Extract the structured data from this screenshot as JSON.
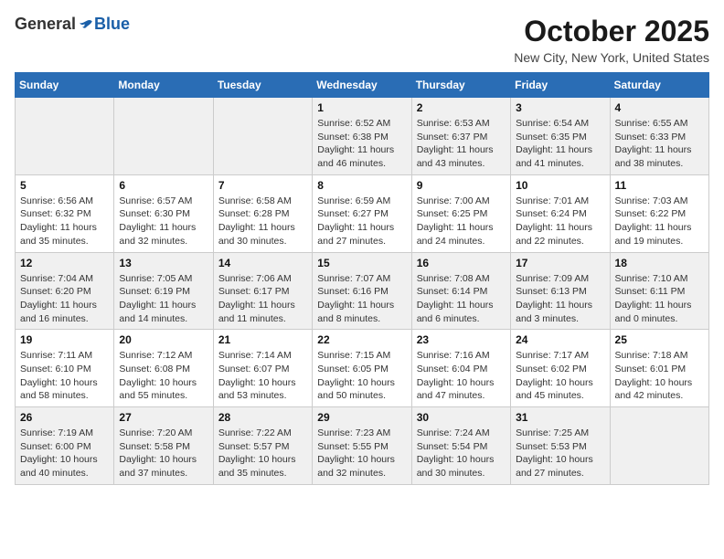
{
  "header": {
    "logo_general": "General",
    "logo_blue": "Blue",
    "month_title": "October 2025",
    "location": "New City, New York, United States"
  },
  "weekdays": [
    "Sunday",
    "Monday",
    "Tuesday",
    "Wednesday",
    "Thursday",
    "Friday",
    "Saturday"
  ],
  "weeks": [
    [
      {
        "day": "",
        "info": ""
      },
      {
        "day": "",
        "info": ""
      },
      {
        "day": "",
        "info": ""
      },
      {
        "day": "1",
        "info": "Sunrise: 6:52 AM\nSunset: 6:38 PM\nDaylight: 11 hours and 46 minutes."
      },
      {
        "day": "2",
        "info": "Sunrise: 6:53 AM\nSunset: 6:37 PM\nDaylight: 11 hours and 43 minutes."
      },
      {
        "day": "3",
        "info": "Sunrise: 6:54 AM\nSunset: 6:35 PM\nDaylight: 11 hours and 41 minutes."
      },
      {
        "day": "4",
        "info": "Sunrise: 6:55 AM\nSunset: 6:33 PM\nDaylight: 11 hours and 38 minutes."
      }
    ],
    [
      {
        "day": "5",
        "info": "Sunrise: 6:56 AM\nSunset: 6:32 PM\nDaylight: 11 hours and 35 minutes."
      },
      {
        "day": "6",
        "info": "Sunrise: 6:57 AM\nSunset: 6:30 PM\nDaylight: 11 hours and 32 minutes."
      },
      {
        "day": "7",
        "info": "Sunrise: 6:58 AM\nSunset: 6:28 PM\nDaylight: 11 hours and 30 minutes."
      },
      {
        "day": "8",
        "info": "Sunrise: 6:59 AM\nSunset: 6:27 PM\nDaylight: 11 hours and 27 minutes."
      },
      {
        "day": "9",
        "info": "Sunrise: 7:00 AM\nSunset: 6:25 PM\nDaylight: 11 hours and 24 minutes."
      },
      {
        "day": "10",
        "info": "Sunrise: 7:01 AM\nSunset: 6:24 PM\nDaylight: 11 hours and 22 minutes."
      },
      {
        "day": "11",
        "info": "Sunrise: 7:03 AM\nSunset: 6:22 PM\nDaylight: 11 hours and 19 minutes."
      }
    ],
    [
      {
        "day": "12",
        "info": "Sunrise: 7:04 AM\nSunset: 6:20 PM\nDaylight: 11 hours and 16 minutes."
      },
      {
        "day": "13",
        "info": "Sunrise: 7:05 AM\nSunset: 6:19 PM\nDaylight: 11 hours and 14 minutes."
      },
      {
        "day": "14",
        "info": "Sunrise: 7:06 AM\nSunset: 6:17 PM\nDaylight: 11 hours and 11 minutes."
      },
      {
        "day": "15",
        "info": "Sunrise: 7:07 AM\nSunset: 6:16 PM\nDaylight: 11 hours and 8 minutes."
      },
      {
        "day": "16",
        "info": "Sunrise: 7:08 AM\nSunset: 6:14 PM\nDaylight: 11 hours and 6 minutes."
      },
      {
        "day": "17",
        "info": "Sunrise: 7:09 AM\nSunset: 6:13 PM\nDaylight: 11 hours and 3 minutes."
      },
      {
        "day": "18",
        "info": "Sunrise: 7:10 AM\nSunset: 6:11 PM\nDaylight: 11 hours and 0 minutes."
      }
    ],
    [
      {
        "day": "19",
        "info": "Sunrise: 7:11 AM\nSunset: 6:10 PM\nDaylight: 10 hours and 58 minutes."
      },
      {
        "day": "20",
        "info": "Sunrise: 7:12 AM\nSunset: 6:08 PM\nDaylight: 10 hours and 55 minutes."
      },
      {
        "day": "21",
        "info": "Sunrise: 7:14 AM\nSunset: 6:07 PM\nDaylight: 10 hours and 53 minutes."
      },
      {
        "day": "22",
        "info": "Sunrise: 7:15 AM\nSunset: 6:05 PM\nDaylight: 10 hours and 50 minutes."
      },
      {
        "day": "23",
        "info": "Sunrise: 7:16 AM\nSunset: 6:04 PM\nDaylight: 10 hours and 47 minutes."
      },
      {
        "day": "24",
        "info": "Sunrise: 7:17 AM\nSunset: 6:02 PM\nDaylight: 10 hours and 45 minutes."
      },
      {
        "day": "25",
        "info": "Sunrise: 7:18 AM\nSunset: 6:01 PM\nDaylight: 10 hours and 42 minutes."
      }
    ],
    [
      {
        "day": "26",
        "info": "Sunrise: 7:19 AM\nSunset: 6:00 PM\nDaylight: 10 hours and 40 minutes."
      },
      {
        "day": "27",
        "info": "Sunrise: 7:20 AM\nSunset: 5:58 PM\nDaylight: 10 hours and 37 minutes."
      },
      {
        "day": "28",
        "info": "Sunrise: 7:22 AM\nSunset: 5:57 PM\nDaylight: 10 hours and 35 minutes."
      },
      {
        "day": "29",
        "info": "Sunrise: 7:23 AM\nSunset: 5:55 PM\nDaylight: 10 hours and 32 minutes."
      },
      {
        "day": "30",
        "info": "Sunrise: 7:24 AM\nSunset: 5:54 PM\nDaylight: 10 hours and 30 minutes."
      },
      {
        "day": "31",
        "info": "Sunrise: 7:25 AM\nSunset: 5:53 PM\nDaylight: 10 hours and 27 minutes."
      },
      {
        "day": "",
        "info": ""
      }
    ]
  ]
}
